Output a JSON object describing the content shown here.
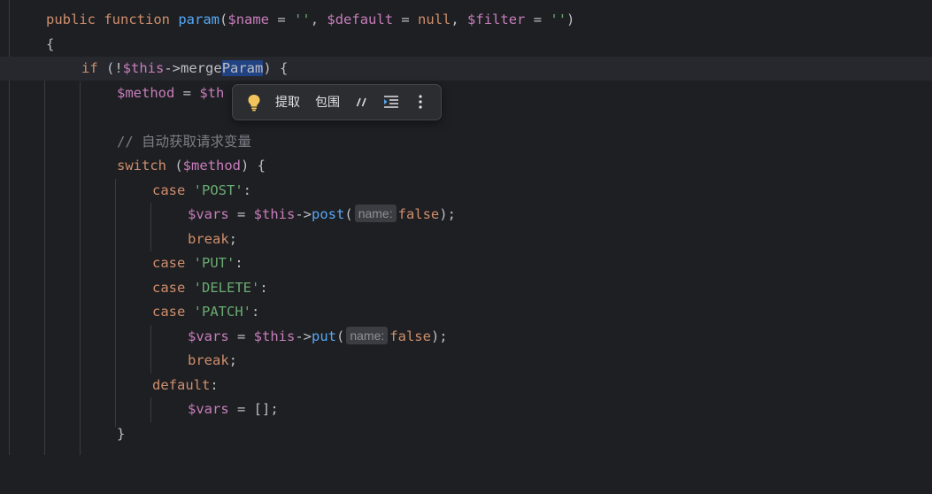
{
  "code": {
    "l0": {
      "kw1": "public",
      "kw2": "function",
      "fn": "param",
      "p1": "$name",
      "p2": "$default",
      "nul": "null",
      "p3": "$filter",
      "s1": "''",
      "s2": "''"
    },
    "l1": {
      "brace": "{"
    },
    "l2": {
      "kw": "if",
      "v": "$this",
      "m1": "merge",
      "m2": "Param"
    },
    "l3": {
      "v1": "$method",
      "v2": "$th"
    },
    "l5": {
      "comment": "// 自动获取请求变量"
    },
    "l6": {
      "kw": "switch",
      "v": "$method"
    },
    "l7": {
      "kw": "case",
      "s": "'POST'"
    },
    "l8": {
      "v1": "$vars",
      "v2": "$this",
      "fn": "post",
      "hint": "name:",
      "kw": "false"
    },
    "l9": {
      "kw": "break"
    },
    "l10": {
      "kw": "case",
      "s": "'PUT'"
    },
    "l11": {
      "kw": "case",
      "s": "'DELETE'"
    },
    "l12": {
      "kw": "case",
      "s": "'PATCH'"
    },
    "l13": {
      "v1": "$vars",
      "v2": "$this",
      "fn": "put",
      "hint": "name:",
      "kw": "false"
    },
    "l14": {
      "kw": "break"
    },
    "l15": {
      "kw": "default"
    },
    "l16": {
      "v": "$vars"
    },
    "l17": {
      "brace": "}"
    }
  },
  "popup": {
    "extract_label": "提取",
    "surround_label": "包围",
    "comment_icon": "comment-icon",
    "reformat_icon": "reformat-icon",
    "bulb_icon": "lightbulb-icon",
    "more_icon": "more-vertical-icon"
  }
}
